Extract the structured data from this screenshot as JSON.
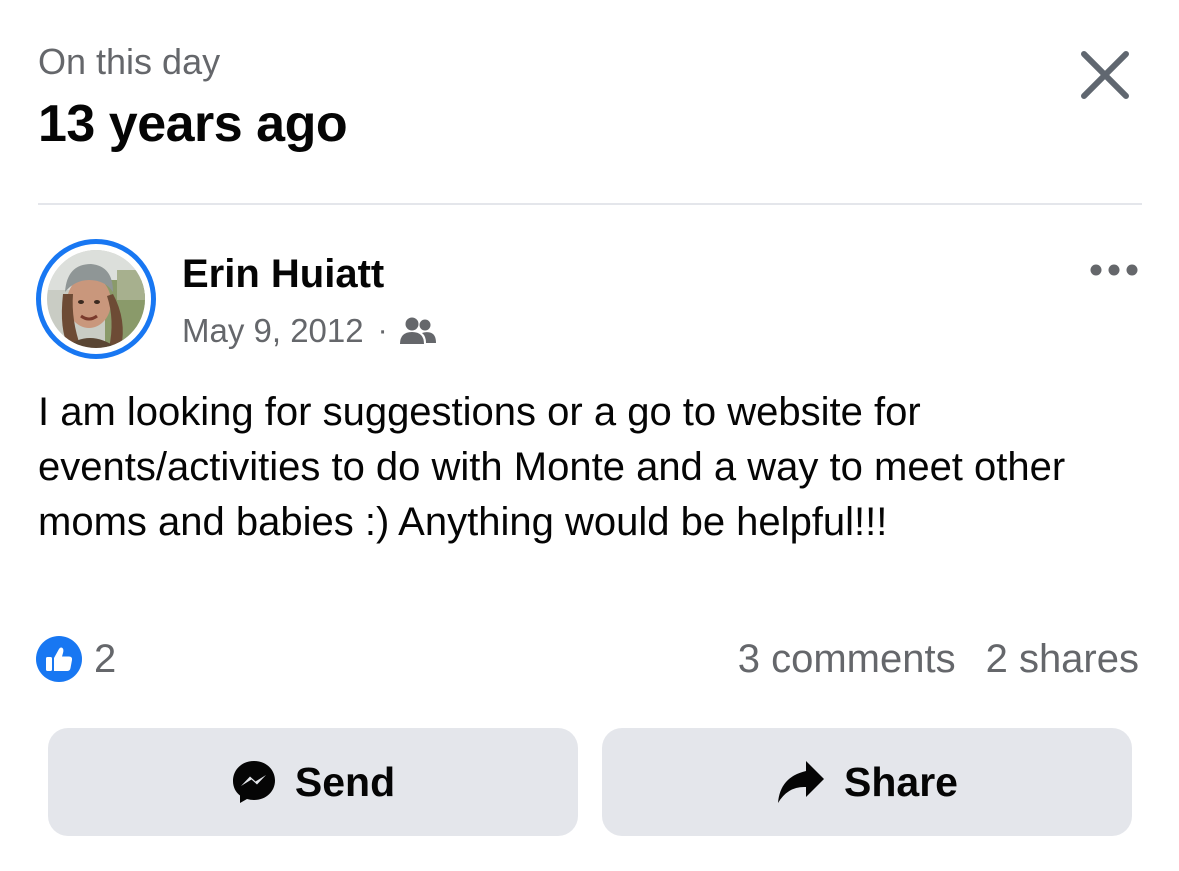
{
  "header": {
    "subtitle": "On this day",
    "title": "13 years ago",
    "close_icon": "close-icon"
  },
  "post": {
    "author": "Erin Huiatt",
    "date": "May 9, 2012",
    "separator": "·",
    "audience_icon": "friends-icon",
    "more_icon": "more-options-icon",
    "text": "I am looking for suggestions or a go to website for events/activities to do with Monte and a way to meet other moms and babies :) Anything would be helpful!!!",
    "avatar_ring_color": "#1877f2"
  },
  "engagement": {
    "like_icon": "like-icon",
    "reaction_count": "2",
    "comments": "3 comments",
    "shares": "2 shares"
  },
  "actions": {
    "send_label": "Send",
    "send_icon": "messenger-icon",
    "share_label": "Share",
    "share_icon": "share-arrow-icon"
  },
  "colors": {
    "accent": "#1877f2",
    "secondary_text": "#65676b",
    "button_bg": "#e4e6eb"
  }
}
